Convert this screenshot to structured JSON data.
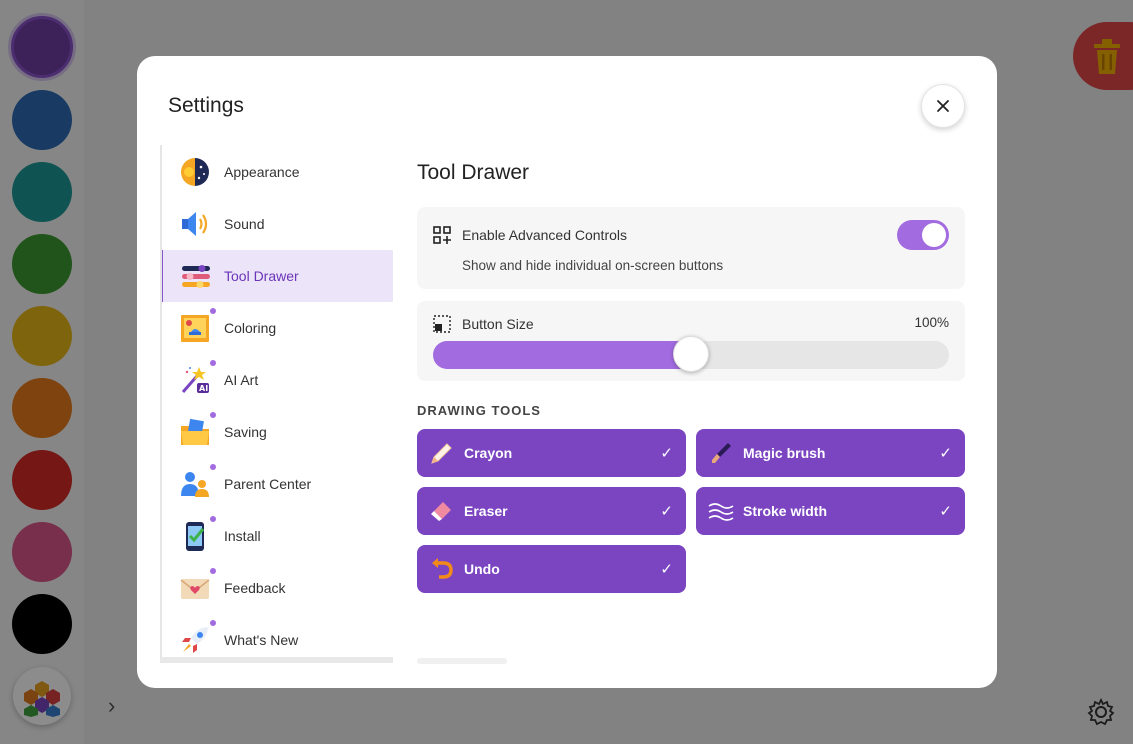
{
  "background": {
    "swatches": [
      {
        "name": "purple",
        "color": "#6d3fa0",
        "selected": true
      },
      {
        "name": "blue",
        "color": "#2e6bb5"
      },
      {
        "name": "teal",
        "color": "#1c9a95"
      },
      {
        "name": "green",
        "color": "#3d9a32"
      },
      {
        "name": "yellow",
        "color": "#e6b818"
      },
      {
        "name": "orange",
        "color": "#e67a1a"
      },
      {
        "name": "red",
        "color": "#d62a27"
      },
      {
        "name": "pink",
        "color": "#d9578a"
      },
      {
        "name": "black",
        "color": "#000000"
      }
    ]
  },
  "modal": {
    "title": "Settings",
    "close_icon": "close-icon",
    "nav": [
      {
        "label": "Appearance",
        "icon": "day-night-icon",
        "active": false,
        "dot": false
      },
      {
        "label": "Sound",
        "icon": "speaker-icon",
        "active": false,
        "dot": false
      },
      {
        "label": "Tool Drawer",
        "icon": "sliders-icon",
        "active": true,
        "dot": false
      },
      {
        "label": "Coloring",
        "icon": "coloring-page-icon",
        "active": false,
        "dot": true
      },
      {
        "label": "AI Art",
        "icon": "magic-wand-ai-icon",
        "active": false,
        "dot": true
      },
      {
        "label": "Saving",
        "icon": "folder-icon",
        "active": false,
        "dot": true
      },
      {
        "label": "Parent Center",
        "icon": "parent-child-icon",
        "active": false,
        "dot": true
      },
      {
        "label": "Install",
        "icon": "phone-check-icon",
        "active": false,
        "dot": true
      },
      {
        "label": "Feedback",
        "icon": "envelope-heart-icon",
        "active": false,
        "dot": true
      },
      {
        "label": "What's New",
        "icon": "rocket-icon",
        "active": false,
        "dot": true
      }
    ],
    "content": {
      "title": "Tool Drawer",
      "advanced": {
        "title": "Enable Advanced Controls",
        "subtitle": "Show and hide individual on-screen buttons",
        "enabled": true
      },
      "button_size": {
        "title": "Button Size",
        "value_label": "100%",
        "level": 0.5
      },
      "drawing_tools_label": "DRAWING TOOLS",
      "tools": [
        {
          "label": "Crayon",
          "icon": "crayon-icon",
          "checked": "✓"
        },
        {
          "label": "Magic brush",
          "icon": "magic-brush-icon",
          "checked": "✓"
        },
        {
          "label": "Eraser",
          "icon": "eraser-icon",
          "checked": "✓"
        },
        {
          "label": "Stroke width",
          "icon": "stroke-width-icon",
          "checked": "✓"
        },
        {
          "label": "Undo",
          "icon": "undo-icon",
          "checked": "✓"
        }
      ]
    }
  }
}
